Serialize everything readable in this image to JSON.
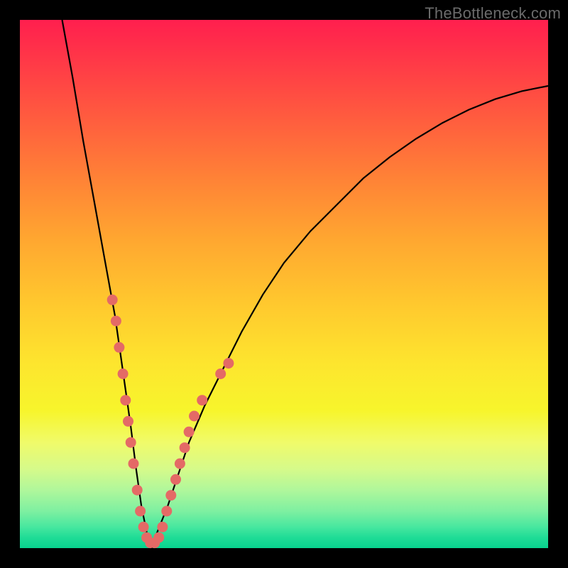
{
  "watermark": "TheBottleneck.com",
  "colors": {
    "background": "#000000",
    "curve": "#000000",
    "scatter": "#e46a66",
    "gradient_top": "#ff1f4e",
    "gradient_bottom": "#08d38e"
  },
  "chart_data": {
    "type": "line",
    "title": "",
    "xlabel": "",
    "ylabel": "",
    "xlim": [
      0,
      100
    ],
    "ylim": [
      0,
      100
    ],
    "legend": false,
    "grid": false,
    "series": [
      {
        "name": "bottleneck-curve",
        "x": [
          8,
          10,
          12,
          14,
          16,
          18,
          19,
          20,
          21,
          22,
          23,
          24,
          25,
          26,
          28,
          30,
          32,
          35,
          38,
          42,
          46,
          50,
          55,
          60,
          65,
          70,
          75,
          80,
          85,
          90,
          95,
          100
        ],
        "values": [
          100,
          89,
          77,
          66,
          55,
          44,
          37,
          30,
          23,
          15,
          8,
          3,
          0,
          3,
          8,
          14,
          20,
          27,
          33,
          41,
          48,
          54,
          60,
          65,
          70,
          74,
          77.5,
          80.5,
          83,
          85,
          86.5,
          87.5
        ]
      }
    ],
    "scatter": {
      "name": "sample-points",
      "points": [
        {
          "x": 17.5,
          "y": 47
        },
        {
          "x": 18.2,
          "y": 43
        },
        {
          "x": 18.8,
          "y": 38
        },
        {
          "x": 19.5,
          "y": 33
        },
        {
          "x": 20.0,
          "y": 28
        },
        {
          "x": 20.5,
          "y": 24
        },
        {
          "x": 21.0,
          "y": 20
        },
        {
          "x": 21.5,
          "y": 16
        },
        {
          "x": 22.2,
          "y": 11
        },
        {
          "x": 22.8,
          "y": 7
        },
        {
          "x": 23.4,
          "y": 4
        },
        {
          "x": 24.0,
          "y": 2
        },
        {
          "x": 24.7,
          "y": 1
        },
        {
          "x": 25.5,
          "y": 1
        },
        {
          "x": 26.3,
          "y": 2
        },
        {
          "x": 27.0,
          "y": 4
        },
        {
          "x": 27.8,
          "y": 7
        },
        {
          "x": 28.6,
          "y": 10
        },
        {
          "x": 29.5,
          "y": 13
        },
        {
          "x": 30.3,
          "y": 16
        },
        {
          "x": 31.2,
          "y": 19
        },
        {
          "x": 32.0,
          "y": 22
        },
        {
          "x": 33.0,
          "y": 25
        },
        {
          "x": 34.5,
          "y": 28
        },
        {
          "x": 38.0,
          "y": 33
        },
        {
          "x": 39.5,
          "y": 35
        }
      ]
    }
  }
}
